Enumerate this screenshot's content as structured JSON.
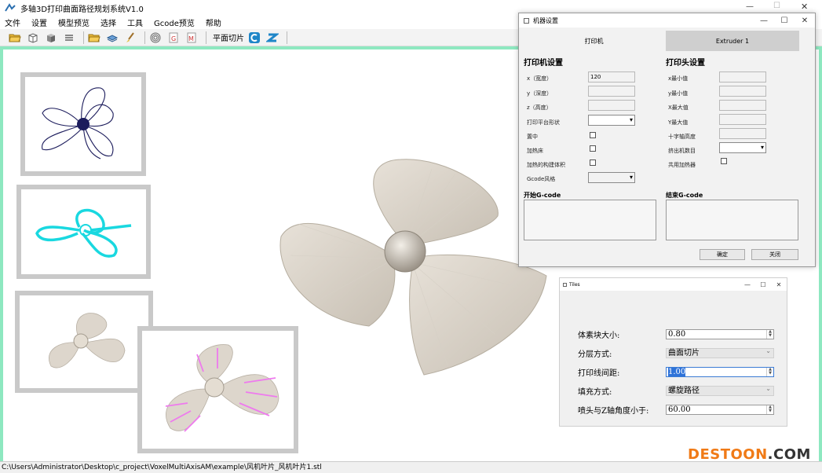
{
  "window": {
    "title": "多轴3D打印曲面路径规划系统V1.0"
  },
  "menu": [
    "文件",
    "设置",
    "模型预览",
    "选择",
    "工具",
    "Gcode预览",
    "帮助"
  ],
  "toolbar": {
    "planar_slice_label": "平面切片",
    "icons": [
      "open-folder-icon",
      "cube-wireframe-icon",
      "cube-solid-icon",
      "layers-icon",
      "open-folder-icon",
      "layer-stack-icon",
      "brush-icon",
      "spiral-icon",
      "gcode-g-icon",
      "gcode-m-icon",
      "c-logo-icon",
      "s-logo-icon"
    ]
  },
  "statusbar": {
    "path": "C:\\Users\\Administrator\\Desktop\\c_project\\VoxelMultiAxisAM\\example\\风机叶片_风机叶片1.stl"
  },
  "machine_dialog": {
    "title": "机器设置",
    "tabs": [
      "打印机",
      "Extruder 1"
    ],
    "printer_section": "打印机设置",
    "head_section": "打印头设置",
    "printer_fields": [
      {
        "label": "x（宽度）",
        "value": "120"
      },
      {
        "label": "y（深度）",
        "value": ""
      },
      {
        "label": "z（高度）",
        "value": ""
      }
    ],
    "printer_shape_label": "打印平台形状",
    "center_label": "置中",
    "heated_bed_label": "加热床",
    "heated_chamber_label": "加热的构建体积",
    "gcode_flavor_label": "Gcode风格",
    "head_fields": [
      "x最小值",
      "y最小值",
      "X最大值",
      "Y最大值",
      "十字轴高度"
    ],
    "extruder_count_label": "挤出机数目",
    "shared_heater_label": "共用加热器",
    "start_gcode_label": "开始G-code",
    "end_gcode_label": "结束G-code",
    "ok_label": "确定",
    "close_label": "关闭"
  },
  "params_dialog": {
    "title": "Tiles",
    "fields": [
      {
        "label": "体素块大小:",
        "value": "0.80",
        "type": "spin"
      },
      {
        "label": "分层方式:",
        "value": "曲面切片",
        "type": "combo"
      },
      {
        "label": "打印线间距:",
        "value": "1.00",
        "type": "spin-selected"
      },
      {
        "label": "填充方式:",
        "value": "螺旋路径",
        "type": "combo"
      },
      {
        "label": "喷头与Z轴角度小于:",
        "value": "60.00",
        "type": "spin"
      }
    ]
  },
  "watermark": {
    "part1": "DESTOON",
    "part2": ".COM"
  }
}
